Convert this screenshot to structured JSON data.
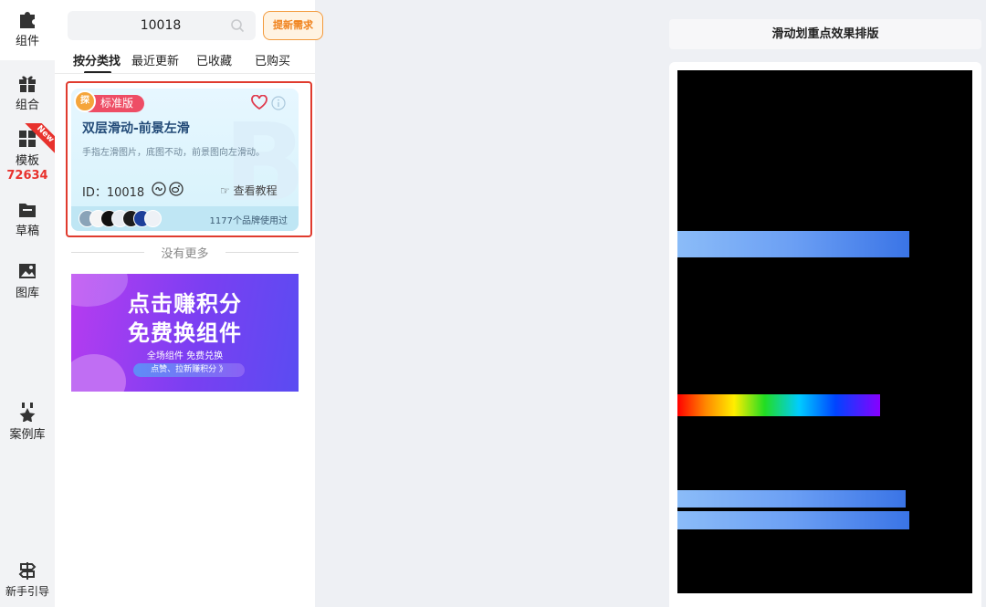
{
  "sidebar": {
    "items": [
      {
        "label": "组件",
        "icon": "puzzle-icon"
      },
      {
        "label": "组合",
        "icon": "gift-icon"
      },
      {
        "label": "模板",
        "icon": "template-grid-icon",
        "count": "72634",
        "ribbon": "New"
      },
      {
        "label": "草稿",
        "icon": "draft-icon"
      },
      {
        "label": "图库",
        "icon": "image-icon"
      },
      {
        "label": "案例库",
        "icon": "medal-star-icon"
      },
      {
        "label": "新手引导",
        "icon": "signpost-icon"
      }
    ]
  },
  "search": {
    "value": "10018",
    "request_button": "提新需求"
  },
  "tabs": [
    "按分类找",
    "最近更新",
    "已收藏",
    "已购买"
  ],
  "active_tab": "按分类找",
  "card": {
    "badge": "标准版",
    "medal": "探",
    "title": "双层滑动-前景左滑",
    "description": "手指左滑图片，底图不动，前景图向左滑动。",
    "id_text": "ID：10018",
    "tutorial": "查看教程",
    "brands_used": "1177个品牌使用过",
    "watermark": "B"
  },
  "no_more": "没有更多",
  "promo": {
    "line1": "点击赚积分",
    "line2": "免费换组件",
    "subtitle": "全场组件 免费兑换",
    "button": "点赞、拉新赚积分  》"
  },
  "preview": {
    "title": "滑动划重点效果排版"
  },
  "colors": {
    "accent_red": "#e03b2e",
    "accent_orange": "#f0821c",
    "badge_pink": "#ee4d65",
    "promo_purple": "#7a3ff2",
    "bar_blue": "#6b9ff4"
  }
}
